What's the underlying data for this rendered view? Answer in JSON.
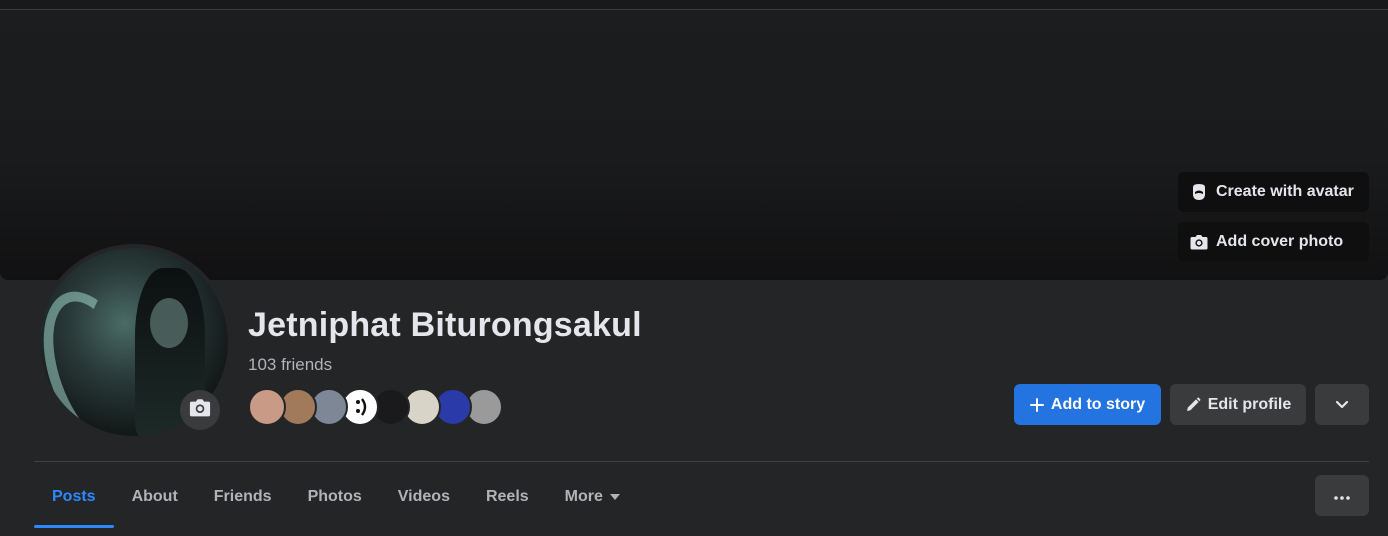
{
  "cover": {
    "create_avatar_label": "Create with avatar",
    "add_cover_label": "Add cover photo"
  },
  "profile": {
    "name": "Jetniphat Biturongsakul",
    "friends_count": "103 friends"
  },
  "actions": {
    "add_story_label": "Add to story",
    "edit_profile_label": "Edit profile"
  },
  "friend_avatars": [
    {
      "icon": "friend-avatar-1",
      "color": "#c99a86"
    },
    {
      "icon": "friend-avatar-2",
      "color": "#a07a5a"
    },
    {
      "icon": "friend-avatar-3",
      "color": "#7d8796"
    },
    {
      "icon": "friend-avatar-4-smiley",
      "color": "#ffffff"
    },
    {
      "icon": "friend-avatar-5",
      "color": "#1a1a1c"
    },
    {
      "icon": "friend-avatar-6",
      "color": "#d9d4c8"
    },
    {
      "icon": "friend-avatar-7",
      "color": "#2a3aa8"
    },
    {
      "icon": "friend-avatar-8",
      "color": "#9a9a9a"
    }
  ],
  "tabs": [
    {
      "label": "Posts",
      "active": true
    },
    {
      "label": "About",
      "active": false
    },
    {
      "label": "Friends",
      "active": false
    },
    {
      "label": "Photos",
      "active": false
    },
    {
      "label": "Videos",
      "active": false
    },
    {
      "label": "Reels",
      "active": false
    },
    {
      "label": "More",
      "active": false
    }
  ],
  "colors": {
    "background": "#242526",
    "accent": "#2374e1",
    "active_tab": "#2d88ff",
    "secondary_button": "#3a3b3c"
  }
}
